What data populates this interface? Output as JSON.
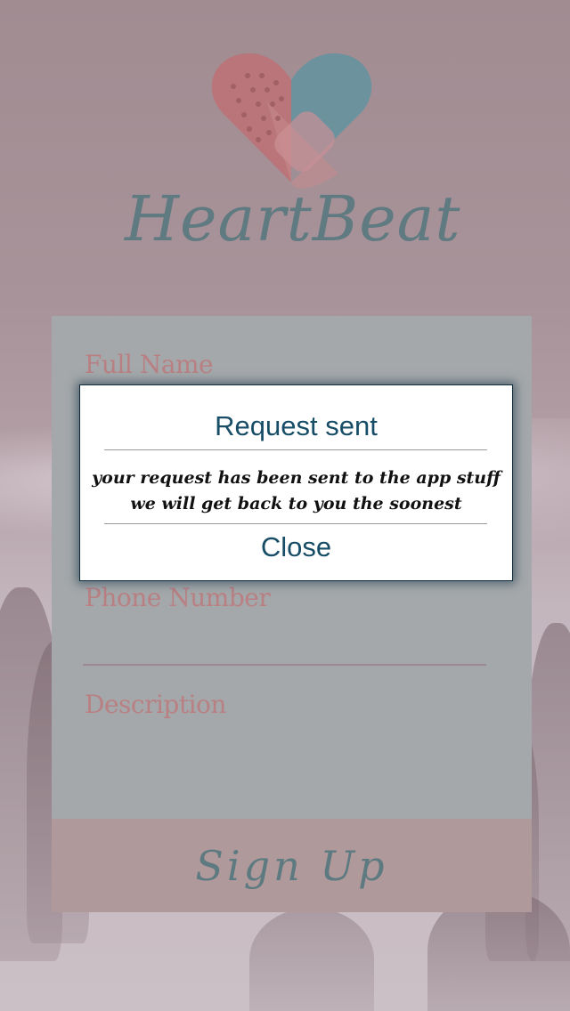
{
  "app": {
    "title": "HeartBeat",
    "logo_icon": "heart-bandage-icon",
    "colors": {
      "logo_pink": "#b97579",
      "logo_blue": "#6c929e",
      "title": "#5f7a80",
      "label": "#b98083",
      "signup_bg": "#b0999b",
      "dialog_text": "#174d66"
    }
  },
  "form": {
    "full_name_label": "Full Name",
    "phone_label": "Phone Number",
    "description_label": "Description",
    "signup_label": "Sign Up"
  },
  "dialog": {
    "title": "Request sent",
    "message_line1": "your request has been sent to the app stuff",
    "message_line2": "we will get back to you the soonest",
    "close_label": "Close"
  }
}
